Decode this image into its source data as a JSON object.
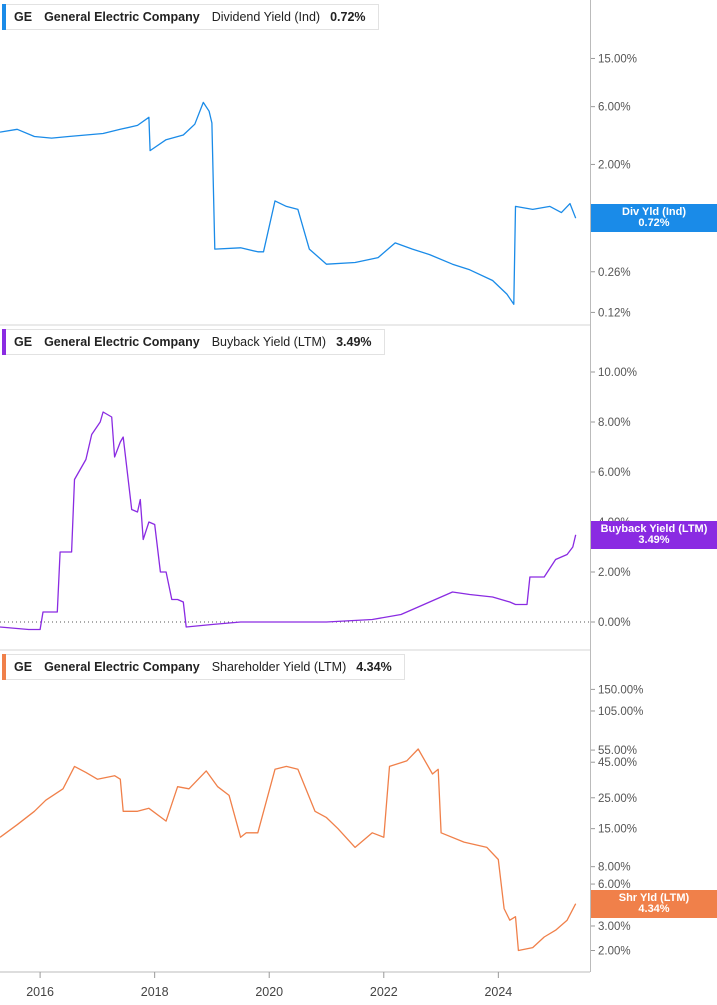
{
  "chart_data": [
    {
      "type": "line",
      "ticker": "GE",
      "company": "General Electric Company",
      "metric": "Dividend Yield (Ind)",
      "latest": "0.72%",
      "flag_label": "Div Yld (Ind)",
      "color": "#1a8be8",
      "scale": "log",
      "ylim": [
        0.11,
        30
      ],
      "yticks": [
        "15.00%",
        "6.00%",
        "2.00%",
        "0.72%",
        "0.26%",
        "0.12%"
      ],
      "ytick_values": [
        15,
        6,
        2,
        0.72,
        0.26,
        0.12
      ],
      "series": [
        {
          "x": [
            2015.3,
            2015.6,
            2015.9,
            2016.2,
            2016.5,
            2016.8,
            2017.1,
            2017.4,
            2017.7,
            2017.9,
            2017.92,
            2018.2,
            2018.5,
            2018.7,
            2018.85,
            2018.95,
            2019.0,
            2019.05,
            2019.5,
            2019.8,
            2019.9,
            2020.1,
            2020.3,
            2020.5,
            2020.7,
            2021.0,
            2021.5,
            2021.9,
            2022.2,
            2022.5,
            2022.8,
            2023.2,
            2023.5,
            2023.9,
            2024.15,
            2024.27,
            2024.3,
            2024.6,
            2024.9,
            2025.1,
            2025.25,
            2025.35
          ],
          "y": [
            3.7,
            3.9,
            3.4,
            3.3,
            3.4,
            3.5,
            3.6,
            3.9,
            4.2,
            4.9,
            2.6,
            3.2,
            3.5,
            4.3,
            6.5,
            5.5,
            4.4,
            0.4,
            0.41,
            0.38,
            0.38,
            1.0,
            0.9,
            0.85,
            0.4,
            0.3,
            0.31,
            0.34,
            0.45,
            0.4,
            0.36,
            0.3,
            0.27,
            0.22,
            0.17,
            0.14,
            0.9,
            0.85,
            0.9,
            0.8,
            0.95,
            0.72
          ]
        }
      ]
    },
    {
      "type": "line",
      "ticker": "GE",
      "company": "General Electric Company",
      "metric": "Buyback Yield (LTM)",
      "latest": "3.49%",
      "flag_label": "Buyback Yield (LTM)",
      "color": "#8a2be2",
      "scale": "linear",
      "ylim": [
        -0.8,
        11
      ],
      "yticks": [
        "10.00%",
        "8.00%",
        "6.00%",
        "4.00%",
        "2.00%",
        "0.00%"
      ],
      "ytick_values": [
        10,
        8,
        6,
        4,
        2,
        0
      ],
      "series": [
        {
          "x": [
            2015.3,
            2015.8,
            2016.0,
            2016.05,
            2016.3,
            2016.35,
            2016.55,
            2016.6,
            2016.8,
            2016.9,
            2017.05,
            2017.1,
            2017.25,
            2017.3,
            2017.4,
            2017.45,
            2017.6,
            2017.7,
            2017.75,
            2017.8,
            2017.9,
            2018.0,
            2018.1,
            2018.2,
            2018.3,
            2018.4,
            2018.5,
            2018.55,
            2019.0,
            2019.5,
            2020.0,
            2021.0,
            2021.8,
            2022.3,
            2022.6,
            2022.9,
            2023.2,
            2023.5,
            2023.9,
            2024.2,
            2024.3,
            2024.5,
            2024.55,
            2024.8,
            2025.0,
            2025.2,
            2025.3,
            2025.35
          ],
          "y": [
            -0.2,
            -0.3,
            -0.3,
            0.4,
            0.4,
            2.8,
            2.8,
            5.7,
            6.5,
            7.5,
            8.0,
            8.4,
            8.2,
            6.6,
            7.2,
            7.4,
            4.5,
            4.4,
            4.9,
            3.3,
            4.0,
            3.9,
            2.0,
            2.0,
            0.9,
            0.9,
            0.8,
            -0.2,
            -0.1,
            0.0,
            0.0,
            0.0,
            0.1,
            0.3,
            0.6,
            0.9,
            1.2,
            1.1,
            1.0,
            0.8,
            0.7,
            0.7,
            1.8,
            1.8,
            2.5,
            2.7,
            3.0,
            3.49
          ]
        }
      ]
    },
    {
      "type": "line",
      "ticker": "GE",
      "company": "General Electric Company",
      "metric": "Shareholder Yield (LTM)",
      "latest": "4.34%",
      "flag_label": "Shr Yld (LTM)",
      "color": "#f0804a",
      "scale": "log",
      "ylim": [
        1.6,
        200
      ],
      "yticks": [
        "150.00%",
        "105.00%",
        "55.00%",
        "45.00%",
        "25.00%",
        "15.00%",
        "8.00%",
        "6.00%",
        "3.00%",
        "2.00%"
      ],
      "ytick_values": [
        150,
        105,
        55,
        45,
        25,
        15,
        8,
        6,
        3,
        2
      ],
      "series": [
        {
          "x": [
            2015.3,
            2015.6,
            2015.9,
            2016.1,
            2016.4,
            2016.6,
            2016.8,
            2017.0,
            2017.3,
            2017.4,
            2017.45,
            2017.7,
            2017.9,
            2018.2,
            2018.4,
            2018.6,
            2018.9,
            2019.1,
            2019.3,
            2019.5,
            2019.6,
            2019.8,
            2020.1,
            2020.3,
            2020.5,
            2020.8,
            2021.0,
            2021.2,
            2021.5,
            2021.8,
            2022.0,
            2022.1,
            2022.4,
            2022.6,
            2022.85,
            2022.95,
            2023.0,
            2023.4,
            2023.8,
            2024.0,
            2024.1,
            2024.2,
            2024.3,
            2024.35,
            2024.6,
            2024.8,
            2025.0,
            2025.2,
            2025.35
          ],
          "y": [
            13,
            16,
            20,
            24,
            29,
            42,
            38,
            34,
            36,
            34,
            20,
            20,
            21,
            17,
            30,
            29,
            39,
            30,
            26,
            13,
            14,
            14,
            40,
            42,
            40,
            20,
            18,
            15,
            11,
            14,
            13,
            42,
            46,
            56,
            37,
            40,
            14,
            12,
            11,
            9,
            4,
            3.3,
            3.5,
            2.0,
            2.1,
            2.5,
            2.8,
            3.3,
            4.34
          ]
        }
      ]
    }
  ],
  "x_axis": {
    "labels": [
      "2016",
      "2018",
      "2020",
      "2022",
      "2024"
    ],
    "values": [
      2016,
      2018,
      2020,
      2022,
      2024
    ],
    "range": [
      2015.3,
      2025.6
    ]
  }
}
